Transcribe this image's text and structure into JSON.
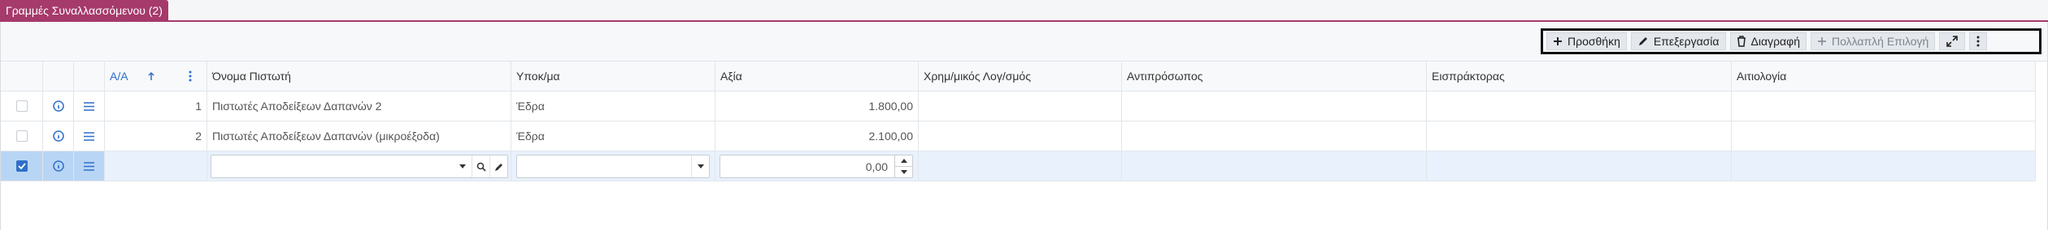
{
  "tab": {
    "title": "Γραμμές Συναλλασσόμενου (2)"
  },
  "toolbar": {
    "add_label": "Προσθήκη",
    "edit_label": "Επεξεργασία",
    "delete_label": "Διαγραφή",
    "multi_label": "Πολλαπλή Επιλογή"
  },
  "columns": {
    "aa": "Α/Α",
    "creditor_name": "Όνομα Πιστωτή",
    "branch": "Υποκ/μα",
    "value": "Αξία",
    "fin_account": "Χρημ/μικός Λογ/σμός",
    "counterpart": "Αντιπρόσωπος",
    "collector": "Εισπράκτορας",
    "reason": "Αιτιολογία"
  },
  "rows": [
    {
      "aa": "1",
      "creditor_name": "Πιστωτές Αποδείξεων Δαπανών 2",
      "branch": "Έδρα",
      "value": "1.800,00"
    },
    {
      "aa": "2",
      "creditor_name": "Πιστωτές Αποδείξεων Δαπανών (μικροέξοδα)",
      "branch": "Έδρα",
      "value": "2.100,00"
    }
  ],
  "new_row": {
    "value_input": "0,00",
    "creditor_input": "",
    "branch_select": ""
  },
  "colors": {
    "accent": "#a53a6b",
    "link_blue": "#2f6fc9",
    "selected_row": "#e8f1fc"
  }
}
